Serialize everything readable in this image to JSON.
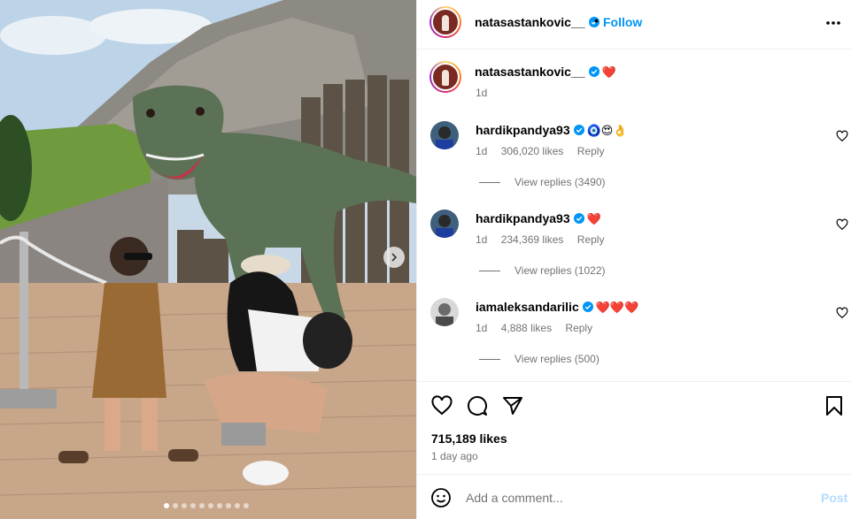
{
  "post": {
    "username": "natasastankovic__",
    "follow_label": "Follow",
    "header_separator": "•",
    "caption_emoji": "❤️",
    "caption_time": "1d"
  },
  "comments": [
    {
      "username": "hardikpandya93",
      "emoji": "🧿😍👌",
      "time": "1d",
      "likes": "306,020 likes",
      "reply_label": "Reply",
      "view_replies": "View replies (3490)"
    },
    {
      "username": "hardikpandya93",
      "emoji": "❤️",
      "time": "1d",
      "likes": "234,369 likes",
      "reply_label": "Reply",
      "view_replies": "View replies (1022)"
    },
    {
      "username": "iamaleksandarilic",
      "emoji": "❤️❤️❤️",
      "time": "1d",
      "likes": "4,888 likes",
      "reply_label": "Reply",
      "view_replies": "View replies (500)"
    }
  ],
  "engagement": {
    "likes_count": "715,189 likes",
    "posted_time": "1 day ago"
  },
  "comment_box": {
    "placeholder": "Add a comment...",
    "post_label": "Post"
  },
  "carousel": {
    "dot_count": 10,
    "active_dot": 1
  },
  "colors": {
    "accent": "#0095f6",
    "verified": "#0095f6",
    "post_disabled": "#b3dbff",
    "muted_text": "#737373",
    "heart": "#e0142b"
  }
}
